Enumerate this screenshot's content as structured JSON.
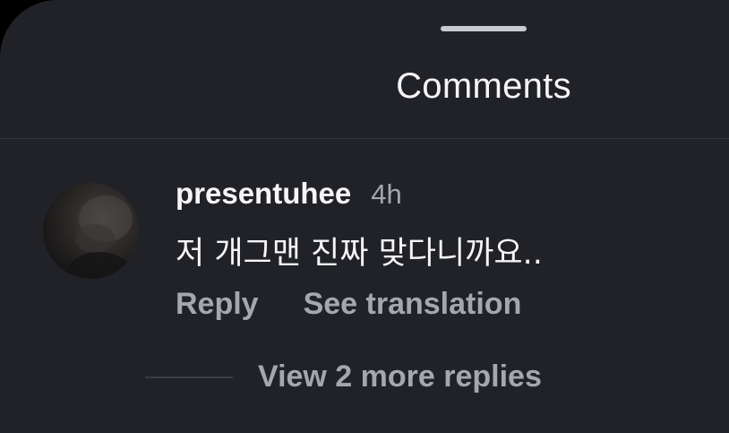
{
  "sheet": {
    "title": "Comments"
  },
  "comment": {
    "username": "presentuhee",
    "timestamp": "4h",
    "text": "저 개그맨 진짜 맞다니까요..",
    "actions": {
      "reply": "Reply",
      "translate": "See translation"
    },
    "replies": {
      "label": "View 2 more replies"
    }
  },
  "colors": {
    "background": "#212227",
    "primary_text": "#f5f5f7",
    "secondary_text": "#a4a7ae",
    "divider": "#34363c"
  }
}
